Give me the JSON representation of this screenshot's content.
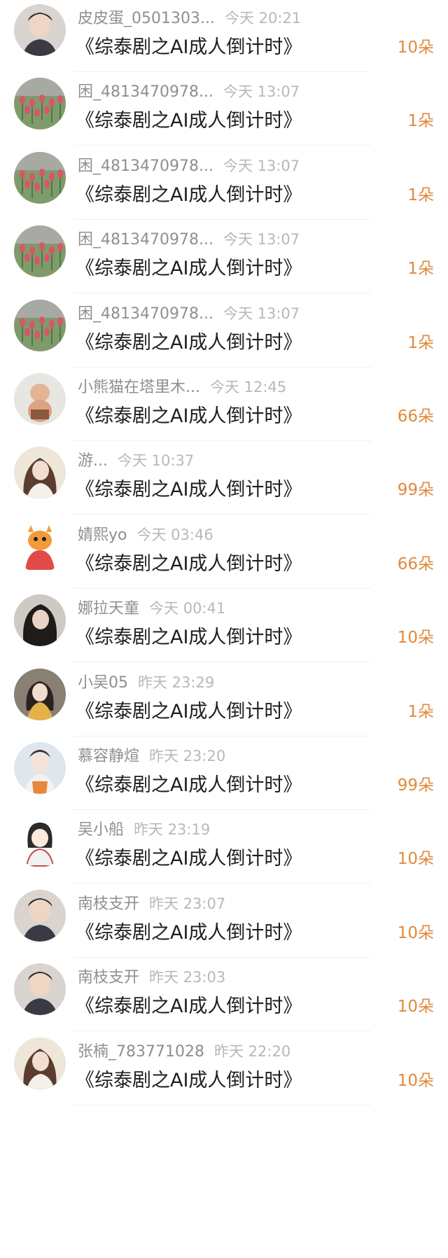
{
  "colors": {
    "accent": "#e08a3c",
    "name": "#8f8f8f",
    "time": "#b8b8b8",
    "title": "#1f1f1f"
  },
  "gifts": [
    {
      "user": "皮皮蛋_0501303...",
      "time": "今天 20:21",
      "title": "《综泰剧之AI成人倒计时》",
      "amount": "10朵",
      "avatar": "boy-portrait-icon"
    },
    {
      "user": "困_4813470978...",
      "time": "今天 13:07",
      "title": "《综泰剧之AI成人倒计时》",
      "amount": "1朵",
      "avatar": "tulip-field-icon"
    },
    {
      "user": "困_4813470978...",
      "time": "今天 13:07",
      "title": "《综泰剧之AI成人倒计时》",
      "amount": "1朵",
      "avatar": "tulip-field-icon"
    },
    {
      "user": "困_4813470978...",
      "time": "今天 13:07",
      "title": "《综泰剧之AI成人倒计时》",
      "amount": "1朵",
      "avatar": "tulip-field-icon"
    },
    {
      "user": "困_4813470978...",
      "time": "今天 13:07",
      "title": "《综泰剧之AI成人倒计时》",
      "amount": "1朵",
      "avatar": "tulip-field-icon"
    },
    {
      "user": "小熊猫在塔里木...",
      "time": "今天 12:45",
      "title": "《综泰剧之AI成人倒计时》",
      "amount": "66朵",
      "avatar": "baby-photo-icon"
    },
    {
      "user": "游...",
      "time": "今天 10:37",
      "title": "《综泰剧之AI成人倒计时》",
      "amount": "99朵",
      "avatar": "girl-portrait-icon"
    },
    {
      "user": "婧熙yo",
      "time": "今天 03:46",
      "title": "《综泰剧之AI成人倒计时》",
      "amount": "66朵",
      "avatar": "cartoon-dragon-icon"
    },
    {
      "user": "娜拉天童",
      "time": "今天 00:41",
      "title": "《综泰剧之AI成人倒计时》",
      "amount": "10朵",
      "avatar": "dark-portrait-icon"
    },
    {
      "user": "小吴05",
      "time": "昨天 23:29",
      "title": "《综泰剧之AI成人倒计时》",
      "amount": "1朵",
      "avatar": "girl-scarf-icon"
    },
    {
      "user": "慕容静煊",
      "time": "昨天 23:20",
      "title": "《综泰剧之AI成人倒计时》",
      "amount": "99朵",
      "avatar": "girl-winter-icon"
    },
    {
      "user": "吴小船",
      "time": "昨天 23:19",
      "title": "《综泰剧之AI成人倒计时》",
      "amount": "10朵",
      "avatar": "cartoon-girl-icon"
    },
    {
      "user": "南枝支开",
      "time": "昨天 23:07",
      "title": "《综泰剧之AI成人倒计时》",
      "amount": "10朵",
      "avatar": "boy-portrait-icon"
    },
    {
      "user": "南枝支开",
      "time": "昨天 23:03",
      "title": "《综泰剧之AI成人倒计时》",
      "amount": "10朵",
      "avatar": "boy-portrait-icon"
    },
    {
      "user": "张楠_783771028",
      "time": "昨天 22:20",
      "title": "《综泰剧之AI成人倒计时》",
      "amount": "10朵",
      "avatar": "girl-portrait-icon"
    }
  ]
}
